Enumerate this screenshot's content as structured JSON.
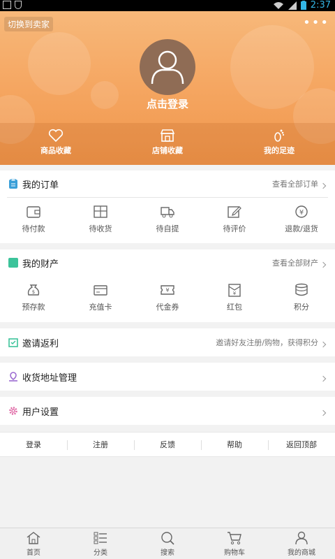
{
  "status_bar": {
    "time": "2:37"
  },
  "header": {
    "switch_label": "切换到卖家",
    "more_icon": "more-dots-icon",
    "login_label": "点击登录",
    "favorites": [
      {
        "label": "商品收藏",
        "icon": "heart-icon"
      },
      {
        "label": "店铺收藏",
        "icon": "store-icon"
      },
      {
        "label": "我的足迹",
        "icon": "footprint-icon"
      }
    ]
  },
  "orders": {
    "title": "我的订单",
    "link": "查看全部订单",
    "items": [
      {
        "label": "待付款",
        "icon": "wallet-icon"
      },
      {
        "label": "待收货",
        "icon": "package-icon"
      },
      {
        "label": "待自提",
        "icon": "truck-icon"
      },
      {
        "label": "待评价",
        "icon": "edit-icon"
      },
      {
        "label": "退款/退货",
        "icon": "refund-icon"
      }
    ]
  },
  "assets": {
    "title": "我的财产",
    "link": "查看全部财产",
    "items": [
      {
        "label": "预存款",
        "icon": "money-bag-icon"
      },
      {
        "label": "充值卡",
        "icon": "card-icon"
      },
      {
        "label": "代金券",
        "icon": "voucher-icon"
      },
      {
        "label": "红包",
        "icon": "red-envelope-icon"
      },
      {
        "label": "积分",
        "icon": "coins-icon"
      }
    ]
  },
  "invite": {
    "title": "邀请返利",
    "link": "邀请好友注册/购物，获得积分"
  },
  "address": {
    "title": "收货地址管理"
  },
  "settings": {
    "title": "用户设置"
  },
  "footer_links": [
    "登录",
    "注册",
    "反馈",
    "帮助",
    "返回顶部"
  ],
  "tabbar": [
    {
      "label": "首页",
      "icon": "home-icon"
    },
    {
      "label": "分类",
      "icon": "category-icon"
    },
    {
      "label": "搜索",
      "icon": "search-icon"
    },
    {
      "label": "购物车",
      "icon": "cart-icon"
    },
    {
      "label": "我的商城",
      "icon": "user-icon"
    }
  ],
  "colors": {
    "header": "#f5a661",
    "orders_icon": "#3a9fd8",
    "assets_icon": "#3cc39a",
    "invite_icon": "#3cc39a",
    "address_icon": "#9b6ad1",
    "settings_icon": "#e06aa6"
  }
}
